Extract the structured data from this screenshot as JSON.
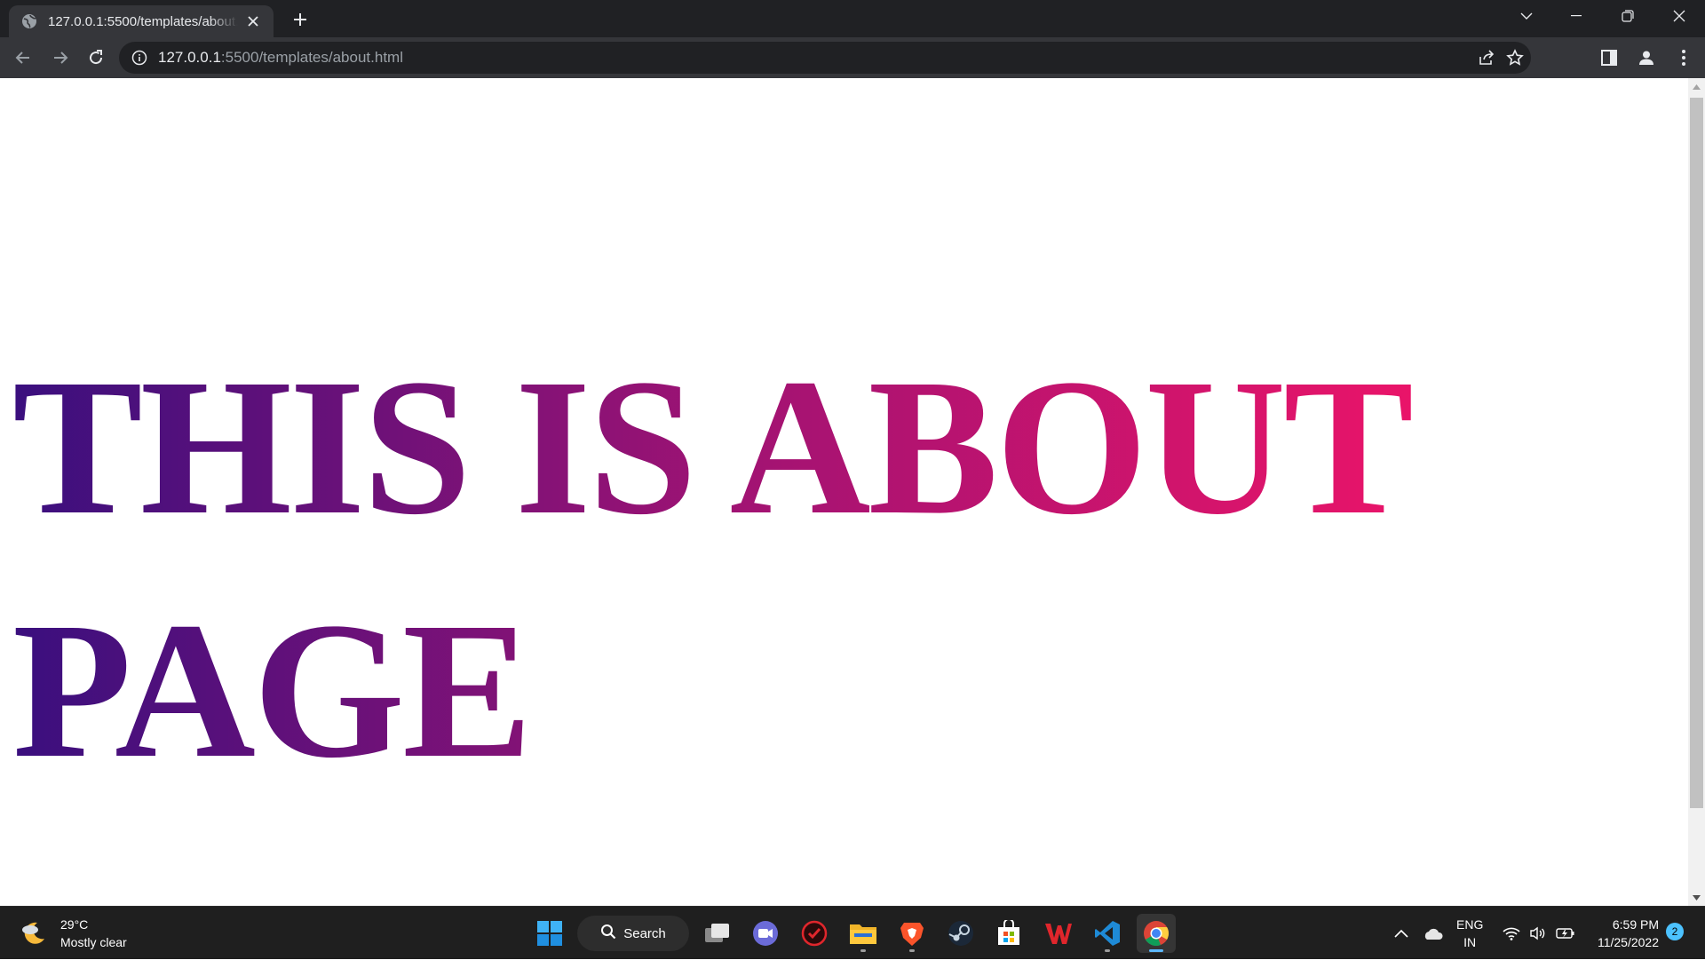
{
  "browser": {
    "tab": {
      "title": "127.0.0.1:5500/templates/about.html",
      "close_icon": "close-icon"
    },
    "new_tab_label": "+",
    "address": {
      "host": "127.0.0.1",
      "rest": ":5500/templates/about.html"
    }
  },
  "page": {
    "heading_words": [
      "THIS",
      "IS",
      "ABOUT",
      "PAGE"
    ],
    "gradient": {
      "start": "#3a0f7e",
      "middle": "#a01373",
      "end": "#ff1466"
    }
  },
  "taskbar": {
    "weather": {
      "temp": "29°C",
      "condition": "Mostly clear"
    },
    "search_label": "Search",
    "apps": [
      "start",
      "search",
      "task-view",
      "meet",
      "antivirus",
      "file-explorer",
      "brave",
      "steam",
      "microsoft-store",
      "wps-office",
      "vscode",
      "chrome"
    ],
    "lang": {
      "line1": "ENG",
      "line2": "IN"
    },
    "clock": {
      "time": "6:59 PM",
      "date": "11/25/2022"
    },
    "notification_count": "2",
    "colors": {
      "accent": "#4cc2ff"
    }
  }
}
